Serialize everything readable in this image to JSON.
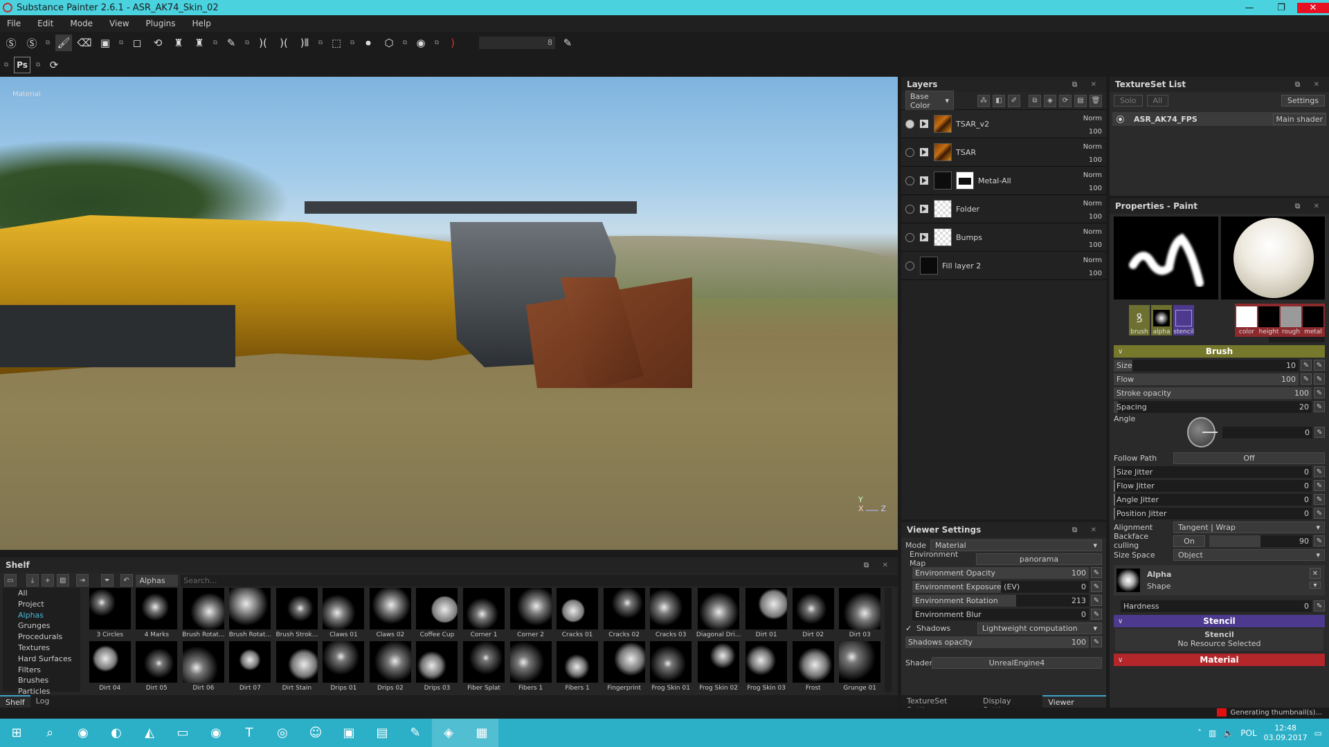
{
  "window": {
    "title": "Substance Painter 2.6.1 - ASR_AK74_Skin_02",
    "minimize": "—",
    "maximize": "❐",
    "close": "✕"
  },
  "menu": [
    "File",
    "Edit",
    "Mode",
    "View",
    "Plugins",
    "Help"
  ],
  "toolbar": {
    "tools": [
      {
        "name": "substance-share-icon",
        "glyph": "Ⓢ"
      },
      {
        "name": "substance-source-icon",
        "glyph": "Ⓢ"
      },
      {
        "name": "paint-brush-icon",
        "glyph": "🖌"
      },
      {
        "name": "eraser-icon",
        "glyph": "⌫"
      },
      {
        "name": "projection-icon",
        "glyph": "▣"
      },
      {
        "name": "polygon-fill-icon",
        "glyph": "◻"
      },
      {
        "name": "smudge-icon",
        "glyph": "⟲"
      },
      {
        "name": "clone-stamp-icon",
        "glyph": "♜"
      },
      {
        "name": "material-picker-icon",
        "glyph": "♜"
      },
      {
        "name": "color-picker-icon",
        "glyph": "✎"
      },
      {
        "name": "symmetry-icon",
        "glyph": ")("
      },
      {
        "name": "symmetry-x-icon",
        "glyph": ")("
      },
      {
        "name": "symmetry-radial-icon",
        "glyph": ")⦀"
      },
      {
        "name": "camera-orthographic-icon",
        "glyph": "⬚"
      },
      {
        "name": "camera-icon",
        "glyph": "⏺"
      },
      {
        "name": "cube-view-icon",
        "glyph": "⬡"
      },
      {
        "name": "screenshot-icon",
        "glyph": "◉"
      },
      {
        "name": "lighting-icon",
        "glyph": ")"
      }
    ],
    "brush_size_value": "8",
    "row2": [
      {
        "name": "photoshop-export-icon",
        "glyph": "Ps"
      },
      {
        "name": "refresh-export-icon",
        "glyph": "⟳"
      }
    ]
  },
  "viewport": {
    "mode_label": "Material",
    "axis": {
      "x": "X",
      "y": "Y",
      "z": "Z"
    }
  },
  "layers": {
    "title": "Layers",
    "channel": "Base Color",
    "tool_icons": [
      "add-effect-icon",
      "add-mask-icon",
      "add-paint-icon",
      "add-layer-icon",
      "add-fill-icon",
      "add-generator-icon",
      "add-folder-icon",
      "delete-icon"
    ],
    "tool_glyphs": [
      "⁂",
      "◧",
      "✐",
      "⧉",
      "◈",
      "⟳",
      "▤",
      "🗑"
    ],
    "items": [
      {
        "name": "TSAR_v2",
        "blend": "Norm",
        "opacity": "100",
        "thumb": "tsar",
        "selected": true
      },
      {
        "name": "TSAR",
        "blend": "Norm",
        "opacity": "100",
        "thumb": "tsar",
        "selected": false
      },
      {
        "name": "Metal-All",
        "blend": "Norm",
        "opacity": "100",
        "thumb": "dark",
        "mask": true,
        "selected": false
      },
      {
        "name": "Folder",
        "blend": "Norm",
        "opacity": "100",
        "thumb": "checker",
        "selected": false
      },
      {
        "name": "Bumps",
        "blend": "Norm",
        "opacity": "100",
        "thumb": "checker",
        "selected": false
      },
      {
        "name": "Fill layer 2",
        "blend": "Norm",
        "opacity": "100",
        "thumb": "fill",
        "selected": false,
        "is_fill": true
      }
    ]
  },
  "textureset": {
    "title": "TextureSet List",
    "solo": "Solo",
    "all": "All",
    "settings": "Settings",
    "items": [
      {
        "name": "ASR_AK74_FPS",
        "shader": "Main shader"
      }
    ]
  },
  "properties": {
    "title": "Properties - Paint",
    "chips_left": [
      {
        "label": "brush",
        "color": "#6d7030"
      },
      {
        "label": "alpha",
        "color": "#6d7030"
      },
      {
        "label": "stencil",
        "color": "#4d3a8e"
      }
    ],
    "chips_right": [
      {
        "label": "color",
        "swatch": "#ffffff"
      },
      {
        "label": "height",
        "swatch": "#000000"
      },
      {
        "label": "rough",
        "swatch": "#9a9a9a"
      },
      {
        "label": "metal",
        "swatch": "#000000"
      }
    ],
    "brush_section": "Brush",
    "sliders": [
      {
        "label": "Size",
        "value": "10",
        "fraction": 0.1
      },
      {
        "label": "Flow",
        "value": "100",
        "fraction": 1.0
      },
      {
        "label": "Stroke opacity",
        "value": "100",
        "fraction": 1.0
      },
      {
        "label": "Spacing",
        "value": "20",
        "fraction": 0.02
      }
    ],
    "angle_label": "Angle",
    "angle_value": "0",
    "follow_path_label": "Follow Path",
    "follow_path_value": "Off",
    "jitters": [
      {
        "label": "Size Jitter",
        "value": "0"
      },
      {
        "label": "Flow Jitter",
        "value": "0"
      },
      {
        "label": "Angle Jitter",
        "value": "0"
      },
      {
        "label": "Position Jitter",
        "value": "0"
      }
    ],
    "alignment_label": "Alignment",
    "alignment_value": "Tangent | Wrap",
    "backface_label": "Backface culling",
    "backface_toggle": "On",
    "backface_value": "90",
    "backface_fraction": 0.5,
    "size_space_label": "Size Space",
    "size_space_value": "Object",
    "alpha_title": "Alpha",
    "alpha_sub": "Shape",
    "hardness_label": "Hardness",
    "hardness_value": "0",
    "stencil_section": "Stencil",
    "stencil_title": "Stencil",
    "stencil_none": "No Resource Selected",
    "material_section": "Material"
  },
  "viewer": {
    "title": "Viewer Settings",
    "mode_label": "Mode",
    "mode_value": "Material",
    "env_map_label": "Environment Map",
    "env_map_value": "panorama",
    "sliders": [
      {
        "label": "Environment Opacity",
        "value": "100",
        "fraction": 1.0
      },
      {
        "label": "Environment Exposure (EV)",
        "value": "0",
        "fraction": 0.5
      },
      {
        "label": "Environment Rotation",
        "value": "213",
        "fraction": 0.59
      },
      {
        "label": "Environment Blur",
        "value": "0",
        "fraction": 0.0
      }
    ],
    "shadows_label": "Shadows",
    "shadows_checked": true,
    "shadows_mode": "Lightweight computation",
    "shadows_opacity_label": "Shadows opacity",
    "shadows_opacity_value": "100",
    "shader_label": "Shader",
    "shader_value": "UnrealEngine4",
    "tabs": [
      {
        "label": "TextureSet Settings",
        "active": false
      },
      {
        "label": "Display Settings",
        "active": false
      },
      {
        "label": "Viewer Settings",
        "active": true
      }
    ]
  },
  "shelf": {
    "title": "Shelf",
    "filter_tag": "Alphas",
    "search_placeholder": "Search...",
    "categories": [
      {
        "label": "All",
        "selected": false
      },
      {
        "label": "Project",
        "selected": false
      },
      {
        "label": "Alphas",
        "selected": true
      },
      {
        "label": "Grunges",
        "selected": false
      },
      {
        "label": "Procedurals",
        "selected": false
      },
      {
        "label": "Textures",
        "selected": false
      },
      {
        "label": "Hard Surfaces",
        "selected": false
      },
      {
        "label": "Filters",
        "selected": false
      },
      {
        "label": "Brushes",
        "selected": false
      },
      {
        "label": "Particles",
        "selected": false
      }
    ],
    "items": [
      "3 Circles",
      "4 Marks",
      "Brush Rotat...",
      "Brush Rotat...",
      "Brush Strok...",
      "Claws 01",
      "Claws 02",
      "Coffee Cup",
      "Corner 1",
      "Corner 2",
      "Cracks 01",
      "Cracks 02",
      "Cracks 03",
      "Diagonal Dri...",
      "Dirt 01",
      "Dirt 02",
      "Dirt 03",
      "Dirt 04",
      "Dirt 05",
      "Dirt 06",
      "Dirt 07",
      "Dirt Stain",
      "Drips 01",
      "Drips 02",
      "Drips 03",
      "Fiber Splat",
      "Fibers 1",
      "Fibers 1",
      "Fingerprint",
      "Frog Skin 01",
      "Frog Skin 02",
      "Frog Skin 03",
      "Frost",
      "Grunge 01"
    ],
    "tabs": [
      {
        "label": "Shelf",
        "active": true
      },
      {
        "label": "Log",
        "active": false
      }
    ]
  },
  "status": {
    "message": "Generating thumbnail(s)..."
  },
  "taskbar": {
    "apps": [
      {
        "name": "start-icon",
        "glyph": "⊞"
      },
      {
        "name": "search-icon",
        "glyph": "⌕"
      },
      {
        "name": "chrome-icon",
        "glyph": "◉"
      },
      {
        "name": "app-icon",
        "glyph": "◐"
      },
      {
        "name": "unity-icon",
        "glyph": "◭"
      },
      {
        "name": "file-explorer-icon",
        "glyph": "▭"
      },
      {
        "name": "spotify-icon",
        "glyph": "◉"
      },
      {
        "name": "teamspeak-icon",
        "glyph": "T"
      },
      {
        "name": "steam-icon",
        "glyph": "◎"
      },
      {
        "name": "discord-icon",
        "glyph": "☺"
      },
      {
        "name": "twitch-icon",
        "glyph": "▣"
      },
      {
        "name": "window-app-icon",
        "glyph": "▤"
      },
      {
        "name": "notepad-icon",
        "glyph": "✎"
      },
      {
        "name": "substance-painter-icon",
        "glyph": "◈",
        "active": true
      },
      {
        "name": "image-viewer-icon",
        "glyph": "▦",
        "active": true
      }
    ],
    "lang": "POL",
    "time": "12:48",
    "date": "03.09.2017"
  }
}
